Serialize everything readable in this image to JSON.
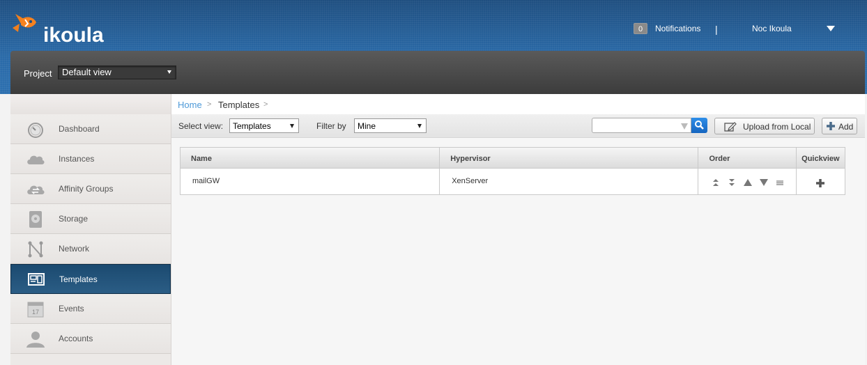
{
  "header": {
    "logo_text": "ikoula",
    "notifications_count": "0",
    "notifications_label": "Notifications",
    "separator": "|",
    "user_name": "Noc Ikoula"
  },
  "project": {
    "label": "Project",
    "selected": "Default view"
  },
  "sidebar": {
    "items": [
      {
        "label": "Dashboard",
        "icon": "dashboard-gauge-icon"
      },
      {
        "label": "Instances",
        "icon": "cloud-icon"
      },
      {
        "label": "Affinity Groups",
        "icon": "cloud-arrows-icon"
      },
      {
        "label": "Storage",
        "icon": "hard-disk-icon"
      },
      {
        "label": "Network",
        "icon": "network-icon"
      },
      {
        "label": "Templates",
        "icon": "templates-icon",
        "active": true
      },
      {
        "label": "Events",
        "icon": "calendar-icon",
        "day": "17"
      },
      {
        "label": "Accounts",
        "icon": "user-icon"
      }
    ]
  },
  "breadcrumb": {
    "home": "Home",
    "arrow": ">",
    "current": "Templates"
  },
  "toolbar": {
    "select_view_label": "Select view:",
    "select_view_value": "Templates",
    "filter_by_label": "Filter by",
    "filter_by_value": "Mine",
    "search_placeholder": "",
    "upload_label": "Upload from Local",
    "add_label": "Add"
  },
  "table": {
    "columns": [
      "Name",
      "Hypervisor",
      "Order",
      "Quickview"
    ],
    "rows": [
      {
        "name": "mailGW",
        "hypervisor": "XenServer"
      }
    ]
  },
  "colors": {
    "header_blue": "#2a6aa8",
    "active_nav": "#1b4a70",
    "link_blue": "#4e9ad8",
    "search_btn": "#1e7ad8"
  }
}
